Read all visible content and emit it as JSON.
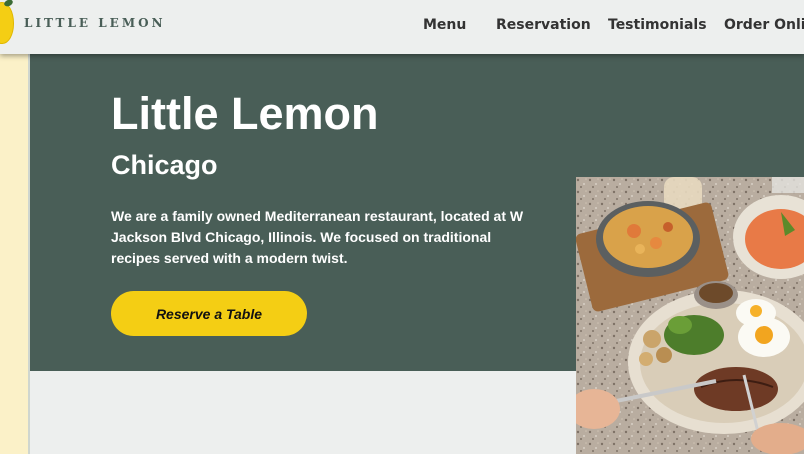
{
  "header": {
    "logo_text": "LITTLE LEMON",
    "nav": [
      {
        "label": "Menu"
      },
      {
        "label": "Reservation"
      },
      {
        "label": "Testimonials"
      },
      {
        "label": "Order Online"
      }
    ]
  },
  "hero": {
    "title": "Little Lemon",
    "subtitle": "Chicago",
    "description": "We are a family owned Mediterranean restaurant, located at W Jackson Blvd Chicago, Illinois. We focused on traditional recipes served with a modern twist.",
    "cta_label": "Reserve a Table"
  },
  "colors": {
    "primary_green": "#495e57",
    "primary_yellow": "#f4ce14",
    "background": "#edefee",
    "accent_cream": "#fbf1c8"
  }
}
